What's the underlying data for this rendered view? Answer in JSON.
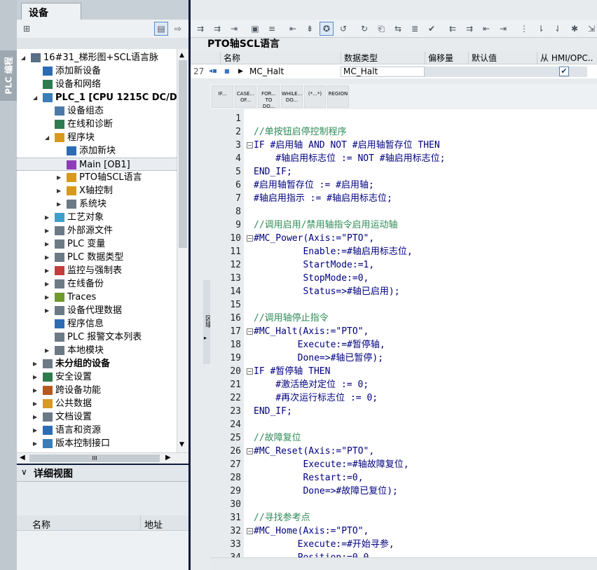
{
  "sidebar_vertical_label": "PLC 编程",
  "device_panel": {
    "tab": "设备",
    "tree": [
      {
        "label": "16#31_梯形图+SCL语言脉",
        "expanded": true
      },
      {
        "label": "添加新设备"
      },
      {
        "label": "设备和网络"
      },
      {
        "label": "PLC_1 [CPU 1215C DC/DC",
        "bold": true,
        "expanded": true
      },
      {
        "label": "设备组态"
      },
      {
        "label": "在线和诊断"
      },
      {
        "label": "程序块",
        "expanded": true
      },
      {
        "label": "添加新块"
      },
      {
        "label": "Main [OB1]",
        "selected": true
      },
      {
        "label": "PTO轴SCL语言",
        "collapsed": true
      },
      {
        "label": "X轴控制",
        "collapsed": true
      },
      {
        "label": "系统块",
        "collapsed": true
      },
      {
        "label": "工艺对象",
        "collapsed": true
      },
      {
        "label": "外部源文件",
        "collapsed": true
      },
      {
        "label": "PLC 变量",
        "collapsed": true
      },
      {
        "label": "PLC 数据类型",
        "collapsed": true
      },
      {
        "label": "监控与强制表",
        "collapsed": true
      },
      {
        "label": "在线备份",
        "collapsed": true
      },
      {
        "label": "Traces",
        "collapsed": true
      },
      {
        "label": "设备代理数据",
        "collapsed": true
      },
      {
        "label": "程序信息"
      },
      {
        "label": "PLC 报警文本列表"
      },
      {
        "label": "本地模块",
        "collapsed": true
      },
      {
        "label": "未分组的设备",
        "bold": true,
        "collapsed": true
      },
      {
        "label": "安全设置",
        "collapsed": true
      },
      {
        "label": "跨设备功能",
        "collapsed": true
      },
      {
        "label": "公共数据",
        "collapsed": true
      },
      {
        "label": "文档设置",
        "collapsed": true
      },
      {
        "label": "语言和资源",
        "collapsed": true
      },
      {
        "label": "版本控制接口",
        "collapsed": true
      }
    ],
    "hscroll_label": "III"
  },
  "detail_view": {
    "title": "详细视图",
    "col_name": "名称",
    "col_address": "地址"
  },
  "editor": {
    "block_title": "PTO轴SCL语言",
    "interface_columns": [
      "名称",
      "数据类型",
      "偏移量",
      "默认值",
      "从 HMI/OPC..."
    ],
    "interface_row": {
      "index": "27",
      "name": "MC_Halt",
      "datatype": "MC_Halt",
      "hmi_checked": true
    },
    "snippets": [
      "IF...",
      "CASE... OF...",
      "FOR... TO DO...",
      "WHILE... DO...",
      "(*...*)",
      "REGION"
    ],
    "side_label": "区域",
    "code_lines": [
      {
        "n": "1",
        "text": ""
      },
      {
        "n": "2",
        "text": "//单按钮启停控制程序",
        "comment": true
      },
      {
        "n": "3",
        "text": "IF #启用轴 AND NOT #启用轴暂存位 THEN",
        "fold": true
      },
      {
        "n": "4",
        "text": "    #轴启用标志位 := NOT #轴启用标志位;"
      },
      {
        "n": "5",
        "text": "END_IF;"
      },
      {
        "n": "6",
        "text": "#启用轴暂存位 := #启用轴;"
      },
      {
        "n": "7",
        "text": "#轴启用指示 := #轴启用标志位;"
      },
      {
        "n": "8",
        "text": ""
      },
      {
        "n": "9",
        "text": "//调用启用/禁用轴指令启用运动轴",
        "comment": true
      },
      {
        "n": "10",
        "text": "#MC_Power(Axis:=\"PTO\",",
        "fold": true
      },
      {
        "n": "11",
        "text": "         Enable:=#轴启用标志位,"
      },
      {
        "n": "12",
        "text": "         StartMode:=1,"
      },
      {
        "n": "13",
        "text": "         StopMode:=0,"
      },
      {
        "n": "14",
        "text": "         Status=>#轴已启用);"
      },
      {
        "n": "15",
        "text": ""
      },
      {
        "n": "16",
        "text": "//调用轴停止指令",
        "comment": true
      },
      {
        "n": "17",
        "text": "#MC_Halt(Axis:=\"PTO\",",
        "fold": true
      },
      {
        "n": "18",
        "text": "        Execute:=#暂停轴,"
      },
      {
        "n": "19",
        "text": "        Done=>#轴已暂停);"
      },
      {
        "n": "20",
        "text": "IF #暂停轴 THEN",
        "fold": true
      },
      {
        "n": "21",
        "text": "    #激活绝对定位 := 0;"
      },
      {
        "n": "22",
        "text": "    #再次运行标志位 := 0;"
      },
      {
        "n": "23",
        "text": "END_IF;"
      },
      {
        "n": "24",
        "text": ""
      },
      {
        "n": "25",
        "text": "//故障复位",
        "comment": true
      },
      {
        "n": "26",
        "text": "#MC_Reset(Axis:=\"PTO\",",
        "fold": true
      },
      {
        "n": "27",
        "text": "         Execute:=#轴故障复位,"
      },
      {
        "n": "28",
        "text": "         Restart:=0,"
      },
      {
        "n": "29",
        "text": "         Done=>#故障已复位);"
      },
      {
        "n": "30",
        "text": ""
      },
      {
        "n": "31",
        "text": "//寻找参考点",
        "comment": true
      },
      {
        "n": "32",
        "text": "#MC_Home(Axis:=\"PTO\",",
        "fold": true
      },
      {
        "n": "33",
        "text": "        Execute:=#开始寻参,"
      },
      {
        "n": "34",
        "text": "        Position:=0.0,"
      }
    ]
  }
}
